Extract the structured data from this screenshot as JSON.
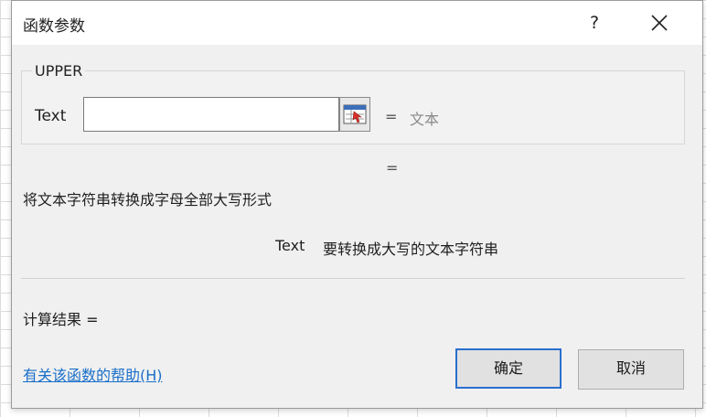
{
  "dialog": {
    "title": "函数参数",
    "help_label": "?",
    "close_icon": "close-icon"
  },
  "function": {
    "name": "UPPER",
    "arg_label": "Text",
    "arg_value": "",
    "ref_icon": "collapse-dialog-icon",
    "eq_sign": "=",
    "eq_value": "文本",
    "result_eq": "="
  },
  "description": {
    "text": "将文本字符串转换成字母全部大写形式",
    "arg_name": "Text",
    "arg_text": "要转换成大写的文本字符串"
  },
  "result": {
    "label": "计算结果 ="
  },
  "footer": {
    "help_link": "有关该函数的帮助(H)",
    "ok_label": "确定",
    "cancel_label": "取消"
  }
}
